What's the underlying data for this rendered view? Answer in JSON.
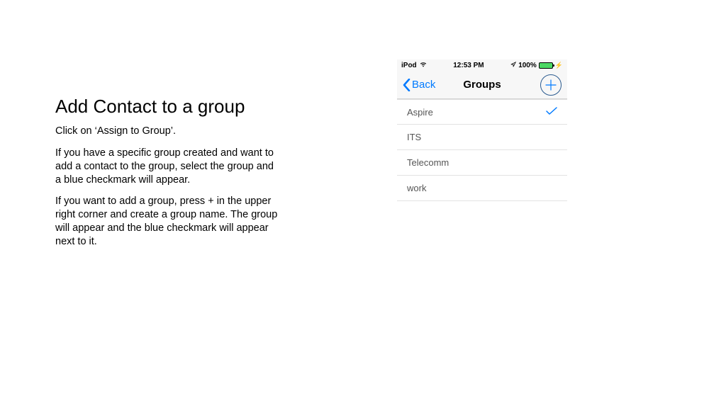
{
  "instructions": {
    "title": "Add Contact to a group",
    "p1": "Click on ‘Assign to Group’.",
    "p2": "If you have a specific group created and want to add a contact to the group, select the group and a blue checkmark will appear.",
    "p3": "If you want to add a group, press + in the upper right corner and create a group name. The group will appear and the blue checkmark will appear next to it."
  },
  "phone": {
    "status": {
      "device": "iPod",
      "time": "12:53 PM",
      "battery_pct": "100%"
    },
    "nav": {
      "back_label": "Back",
      "title": "Groups"
    },
    "groups": [
      {
        "name": "Aspire",
        "selected": true
      },
      {
        "name": "ITS",
        "selected": false
      },
      {
        "name": "Telecomm",
        "selected": false
      },
      {
        "name": "work",
        "selected": false
      }
    ]
  }
}
